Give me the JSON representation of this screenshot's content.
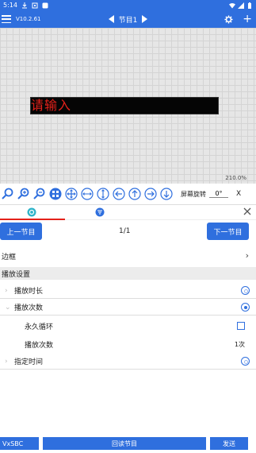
{
  "status_bar": {
    "time": "5:14"
  },
  "app_bar": {
    "version": "V10.2.61",
    "program_title": "节目1"
  },
  "canvas": {
    "screen_text": "请输入",
    "zoom": "210.0%"
  },
  "toolbar": {
    "rotation_label": "屏幕旋转",
    "rotation_value": "0°",
    "close_label": "X"
  },
  "nav": {
    "prev_label": "上一节目",
    "next_label": "下一节目",
    "page": "1/1"
  },
  "settings": {
    "border_label": "边框",
    "play_section_title": "播放设置",
    "duration_label": "播放时长",
    "times_label": "播放次数",
    "loop_label": "永久循环",
    "count_label": "播放次数",
    "count_value": "1次",
    "schedule_label": "指定时间"
  },
  "bottom": {
    "sbc_label": "VxSBC",
    "read_label": "回读节目",
    "send_label": "发送"
  },
  "colors": {
    "primary": "#2f6fde",
    "led_text": "#e4211a",
    "accent": "#e4211a"
  }
}
